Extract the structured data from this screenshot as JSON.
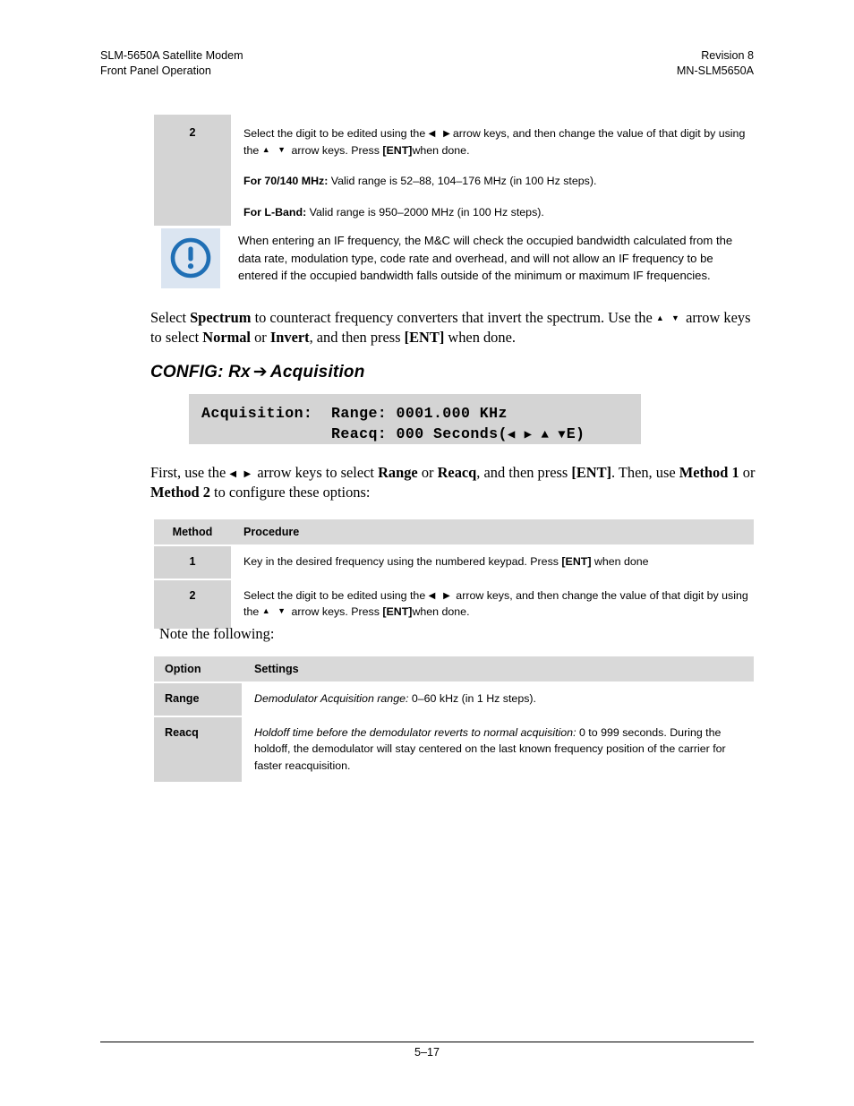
{
  "header": {
    "left_line1": "SLM-5650A Satellite Modem",
    "left_line2": "Front Panel Operation",
    "right_line1": "Revision 8",
    "right_line2": "MN-SLM5650A"
  },
  "step_table": {
    "step_number": "2",
    "instruction_prefix": "Select the digit to be edited using the",
    "arrow_lr": "◀  ▶",
    "instruction_mid": "arrow keys, and then change the value of that digit by using the",
    "arrow_ud": "▲ ▼",
    "instruction_suffix_1": "arrow keys. Press",
    "ent_key": "[ENT]",
    "instruction_suffix_2": "when done.",
    "range_70_140_label": "For 70/140 MHz:",
    "range_70_140_text": "Valid range is 52–88, 104–176 MHz (in 100 Hz steps).",
    "range_lband_label": "For L-Band:",
    "range_lband_text": "Valid range is 950–2000 MHz (in 100 Hz steps)."
  },
  "note_box": {
    "icon": "exclamation-circle-icon",
    "icon_color": "#1f6fb5",
    "background_color": "#dbe5f1",
    "text": "When entering an IF frequency, the M&C will check the occupied bandwidth calculated from the data rate, modulation type, code rate  and overhead,  and will not allow an IF frequency to be entered if the occupied bandwidth falls outside of the minimum or maximum IF frequencies."
  },
  "spectrum_paragraph": {
    "part1": "Select",
    "bold1": "Spectrum",
    "part2": "to counteract frequency converters that invert the spectrum. Use the",
    "arrow_ud": "▲ ▼",
    "part3": "arrow keys to select",
    "bold2": "Normal",
    "part4": "or",
    "bold3": "Invert",
    "part5": ", and then press",
    "bold4": "[ENT]",
    "part6": "when done."
  },
  "section_heading": {
    "prefix": "CONFIG: Rx",
    "arrow": "➔",
    "suffix": "Acquisition"
  },
  "lcd_display": {
    "line1": "Acquisition:  Range: 0001.000 KHz",
    "line2_prefix": "              Reacq: 000 Seconds(",
    "line2_arrows": "◀ ▶ ▲ ▼",
    "line2_suffix": "E)",
    "background_color": "#d4d4d4"
  },
  "first_paragraph": {
    "part1": "First, use the",
    "arrow_lr": "◀  ▶",
    "part2": "arrow keys to select",
    "bold1": "Range",
    "part3": "or",
    "bold2": "Reacq",
    "part4": ", and then press",
    "bold3": "[ENT]",
    "part5": ". Then, use",
    "bold4": "Method 1",
    "part6": "or",
    "bold5": "Method 2",
    "part7": "to configure these options:"
  },
  "method_table": {
    "headers": [
      "Method",
      "Procedure"
    ],
    "rows": [
      {
        "method": "1",
        "procedure_part1": "Key in the desired frequency using the numbered keypad. Press",
        "procedure_bold": "[ENT]",
        "procedure_part2": "when done"
      },
      {
        "method": "2",
        "procedure_part1": "Select the digit to be edited using the",
        "arrow_lr": "◀  ▶",
        "procedure_part2": "arrow keys, and then change the value of that digit by using the",
        "arrow_ud": "▲ ▼",
        "procedure_part3": "arrow keys. Press",
        "procedure_bold": "[ENT]",
        "procedure_part4": "when done."
      }
    ]
  },
  "note_following_text": "Note the following:",
  "option_table": {
    "headers": [
      "Option",
      "Settings"
    ],
    "rows": [
      {
        "option": "Range",
        "settings_italic": "Demodulator Acquisition range:",
        "settings_text": "0–60 kHz (in 1 Hz steps)."
      },
      {
        "option": "Reacq",
        "settings_italic": "Holdoff time before the demodulator reverts to normal acquisition:",
        "settings_text": "0 to 999 seconds. During the holdoff, the demodulator will stay centered on the last known frequency position of the carrier for faster reacquisition."
      }
    ]
  },
  "footer": {
    "page_number": "5–17"
  }
}
